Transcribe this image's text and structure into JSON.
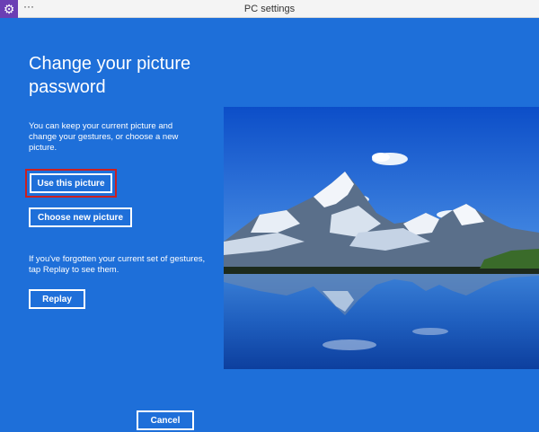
{
  "window": {
    "title": "PC settings",
    "app_icon": "gear-icon",
    "menu_label": "···"
  },
  "main": {
    "title": "Change your picture password",
    "description": "You can keep your current picture and change your gestures, or choose a new picture.",
    "use_picture_label": "Use this picture",
    "choose_picture_label": "Choose new picture",
    "forgotten_text": "If you've forgotten your current set of gestures, tap Replay to see them.",
    "replay_label": "Replay",
    "cancel_label": "Cancel"
  },
  "colors": {
    "background": "#1e6fd9",
    "highlight": "#cc1f1f",
    "app_icon_bg": "#6b3fb4"
  }
}
